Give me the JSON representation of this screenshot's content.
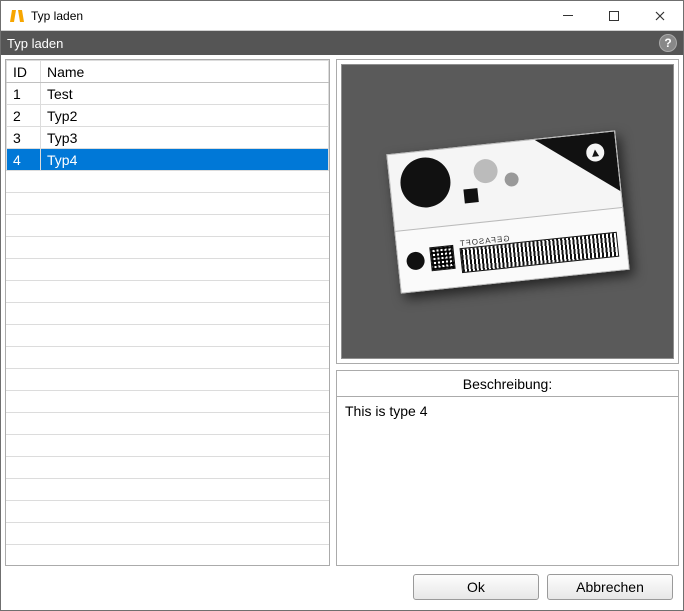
{
  "window": {
    "title": "Typ laden"
  },
  "subheader": {
    "title": "Typ laden"
  },
  "table": {
    "headers": {
      "id": "ID",
      "name": "Name"
    },
    "rows": [
      {
        "id": "1",
        "name": "Test",
        "selected": false
      },
      {
        "id": "2",
        "name": "Typ2",
        "selected": false
      },
      {
        "id": "3",
        "name": "Typ3",
        "selected": false
      },
      {
        "id": "4",
        "name": "Typ4",
        "selected": true
      }
    ]
  },
  "preview": {
    "brand": "GEFASOFT"
  },
  "description": {
    "label": "Beschreibung:",
    "text": "This is type 4"
  },
  "buttons": {
    "ok": "Ok",
    "cancel": "Abbrechen"
  }
}
